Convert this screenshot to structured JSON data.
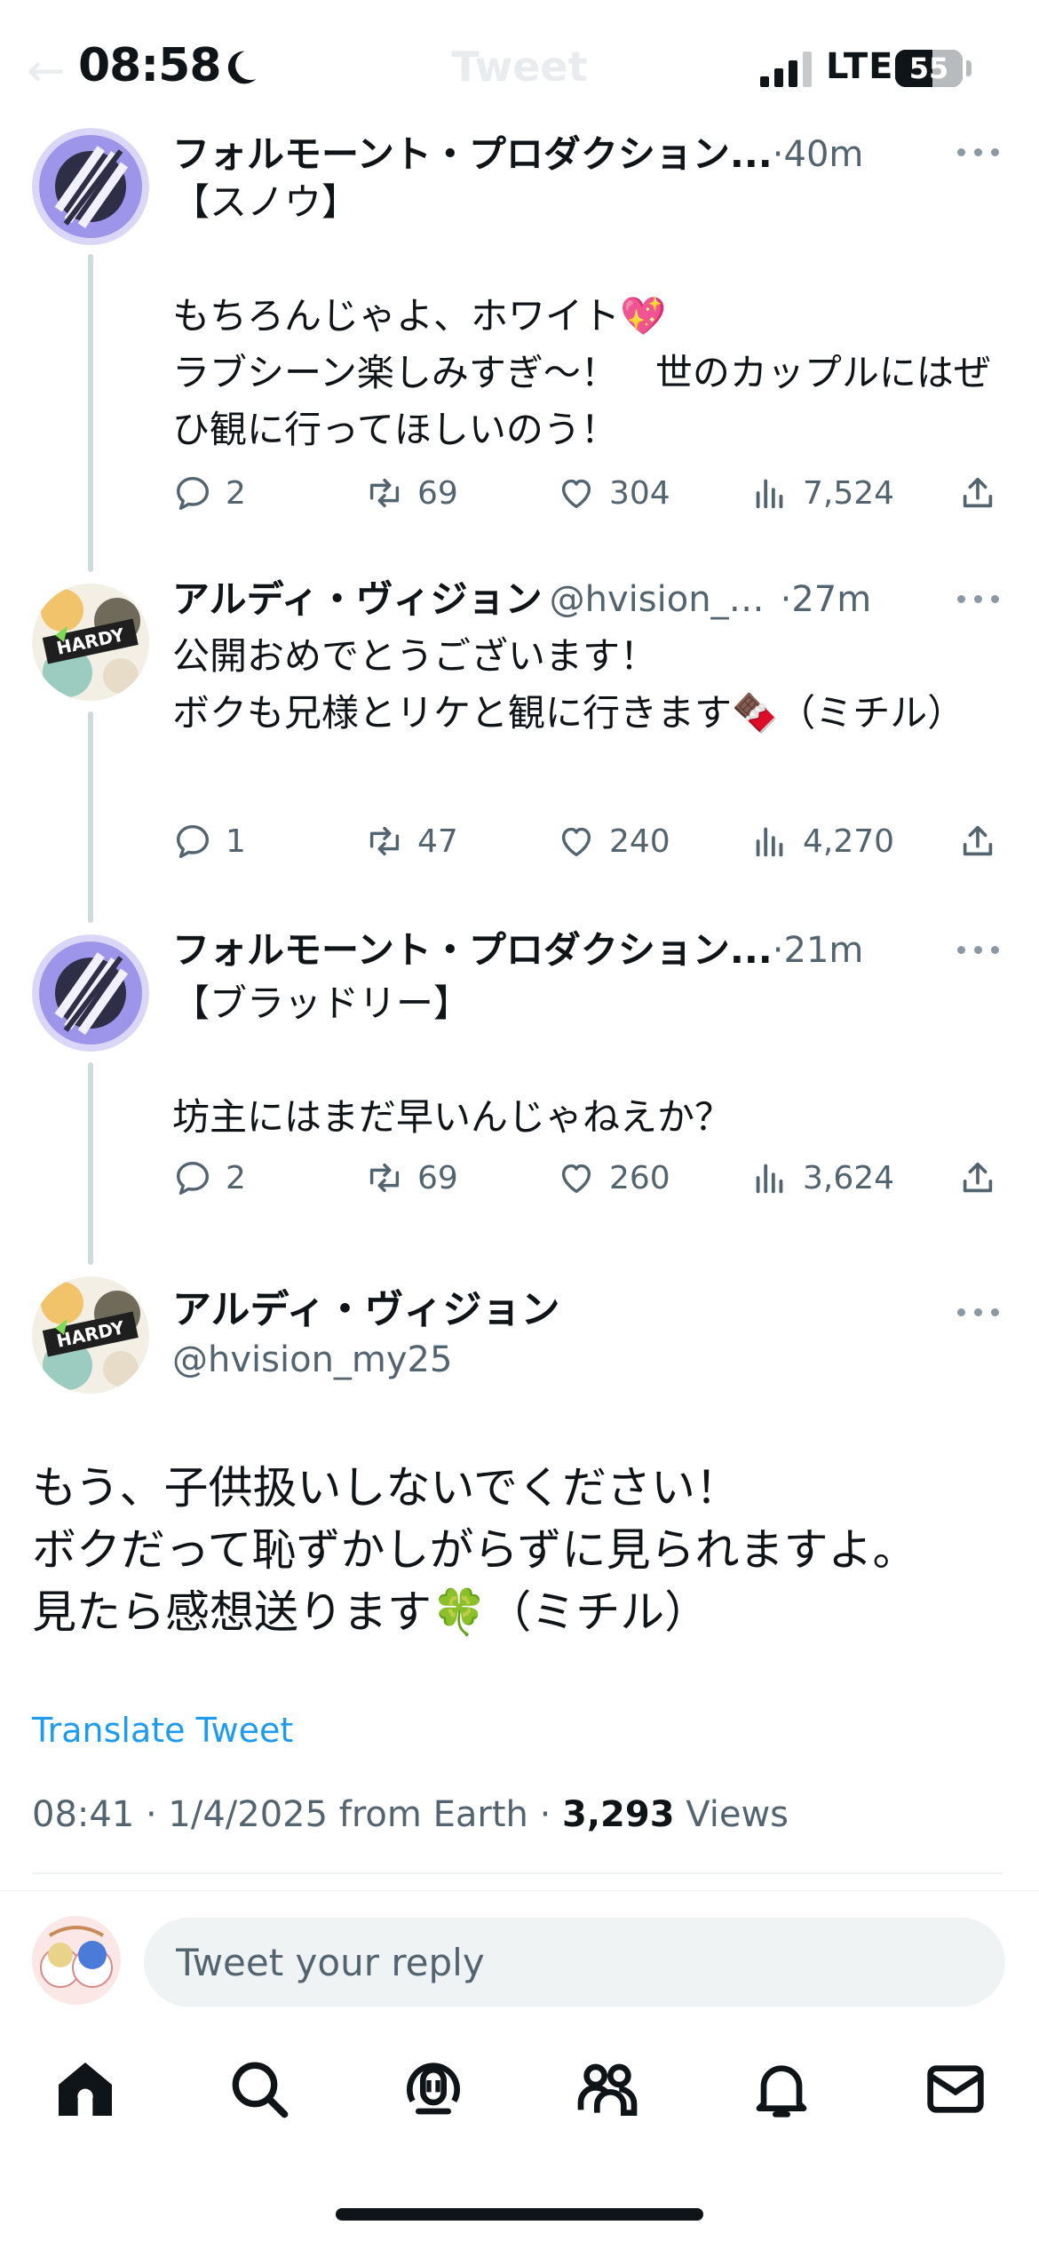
{
  "status_bar": {
    "time": "08:58",
    "network": "LTE",
    "battery_level": "55",
    "battery_fraction": 0.55
  },
  "header": {
    "title": "Tweet"
  },
  "thread": [
    {
      "author_name": "フォルモーント・プロダクション...",
      "handle": "",
      "time_ago": "40m",
      "avatar": "folmond-production-logo",
      "text": "【スノウ】\n\nもちろんじゃよ、ホワイト💖\nラブシーン楽しみすぎ〜！　世のカップルにはぜひ観に行ってほしいのう！",
      "replies": "2",
      "retweets": "69",
      "likes": "304",
      "views": "7,524"
    },
    {
      "author_name": "アルディ・ヴィジョン",
      "handle": "@hvision_m...",
      "time_ago": "27m",
      "avatar": "hardy-vision-logo",
      "text": "公開おめでとうございます！\nボクも兄様とリケと観に行きます🍫（ミチル）",
      "replies": "1",
      "retweets": "47",
      "likes": "240",
      "views": "4,270"
    },
    {
      "author_name": "フォルモーント・プロダクション...",
      "handle": "",
      "time_ago": "21m",
      "avatar": "folmond-production-logo",
      "text": "【ブラッドリー】\n\n坊主にはまだ早いんじゃねえか？",
      "replies": "2",
      "retweets": "69",
      "likes": "260",
      "views": "3,624"
    }
  ],
  "main_tweet": {
    "author_name": "アルディ・ヴィジョン",
    "handle": "@hvision_my25",
    "avatar": "hardy-vision-logo",
    "text": "もう、子供扱いしないでください！\nボクだって恥ずかしがらずに見られますよ。\n見たら感想送ります🍀（ミチル）",
    "translate_label": "Translate Tweet",
    "timestamp": "08:41 · 1/4/2025 from Earth · ",
    "views_count": "3,293",
    "views_label": " Views"
  },
  "reply": {
    "placeholder": "Tweet your reply"
  },
  "tab_bar": [
    {
      "icon": "home-icon"
    },
    {
      "icon": "search-icon"
    },
    {
      "icon": "spaces-icon"
    },
    {
      "icon": "communities-icon"
    },
    {
      "icon": "notifications-icon"
    },
    {
      "icon": "messages-icon"
    }
  ],
  "colors": {
    "text": "#0f1419",
    "secondary": "#536471",
    "link": "#1d9bf0",
    "thread_line": "#cfd9de",
    "input_bg": "#eff3f4"
  }
}
